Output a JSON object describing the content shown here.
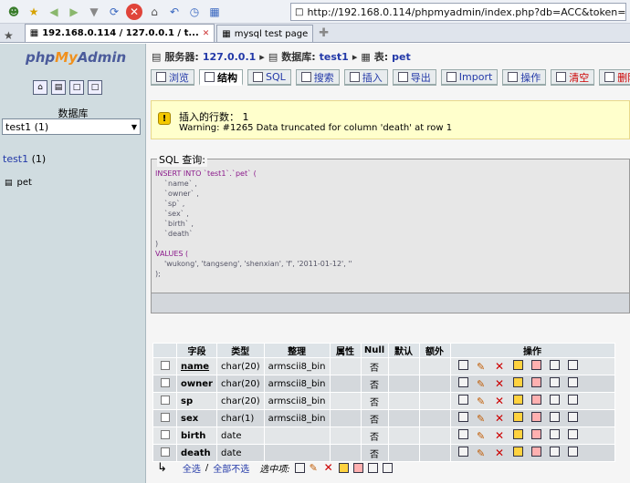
{
  "browser": {
    "url": "http://192.168.0.114/phpmyadmin/index.php?db=ACC&token=",
    "tabs": [
      {
        "label": "192.168.0.114 / 127.0.0.1 / t..."
      },
      {
        "label": "mysql test page"
      }
    ]
  },
  "leftnav": {
    "logo_php": "php",
    "logo_my": "My",
    "logo_admin": "Admin",
    "db_label": "数据库",
    "db_selected": "test1 (1)",
    "db_link_name": "test1",
    "db_link_count": "(1)",
    "table_name": "pet"
  },
  "breadcrumb": {
    "server_label": "服务器:",
    "server": "127.0.0.1",
    "db_label": "数据库:",
    "db": "test1",
    "table_label": "表:",
    "table": "pet"
  },
  "tabs": [
    {
      "label": "浏览"
    },
    {
      "label": "结构"
    },
    {
      "label": "SQL"
    },
    {
      "label": "搜索"
    },
    {
      "label": "插入"
    },
    {
      "label": "导出"
    },
    {
      "label": "Import"
    },
    {
      "label": "操作"
    },
    {
      "label": "清空"
    },
    {
      "label": "删除"
    }
  ],
  "notice": {
    "line1": "插入的行数： 1",
    "line2": "Warning: #1265 Data truncated for column 'death' at row 1"
  },
  "sql": {
    "legend": "SQL 查询:",
    "lines": [
      "INSERT INTO `test1`.`pet` (",
      "`name` ,",
      "`owner` ,",
      "`sp` ,",
      "`sex` ,",
      "`birth` ,",
      "`death`",
      ")",
      "VALUES (",
      "'wukong', 'tangseng', 'shenxian', 'f', '2011-01-12', ''",
      ");"
    ]
  },
  "structure": {
    "headers": [
      "字段",
      "类型",
      "整理",
      "属性",
      "Null",
      "默认",
      "额外",
      "操作"
    ],
    "rows": [
      {
        "field": "name",
        "type": "char(20)",
        "collation": "armscii8_bin",
        "null": "否"
      },
      {
        "field": "owner",
        "type": "char(20)",
        "collation": "armscii8_bin",
        "null": "否"
      },
      {
        "field": "sp",
        "type": "char(20)",
        "collation": "armscii8_bin",
        "null": "否"
      },
      {
        "field": "sex",
        "type": "char(1)",
        "collation": "armscii8_bin",
        "null": "否"
      },
      {
        "field": "birth",
        "type": "date",
        "collation": "",
        "null": "否"
      },
      {
        "field": "death",
        "type": "date",
        "collation": "",
        "null": "否"
      }
    ]
  },
  "footer": {
    "check_all": "全选",
    "separator": "/",
    "uncheck_all": "全部不选",
    "with_selected": "选中项:"
  }
}
